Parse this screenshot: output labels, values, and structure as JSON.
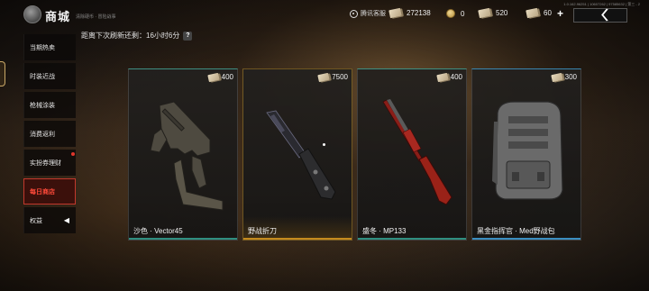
{
  "header": {
    "title": "商城",
    "subtitle": "清除硬币 · 冒险战事",
    "version": "1.0.162.96251 | 10607262 | 97585632 | 第三 - 2",
    "service_label": "腾讯客服",
    "currencies": [
      {
        "icon": "ticket-icon",
        "value": "272138"
      },
      {
        "icon": "coin-icon",
        "value": "0"
      },
      {
        "icon": "ticket-icon",
        "value": "520"
      },
      {
        "icon": "ticket-icon",
        "value": "60"
      }
    ],
    "plus_label": "+",
    "back_label": "〈"
  },
  "refresh": {
    "text": "距离下次刷新还剩：16小时6分",
    "help": "?"
  },
  "sidebar": {
    "items": [
      {
        "label": "当期热卖"
      },
      {
        "label": "时装近战"
      },
      {
        "label": "枪械涂装"
      },
      {
        "label": "消费返利"
      },
      {
        "label": "实扮券理财"
      },
      {
        "label": "每日商店"
      },
      {
        "label": "权益"
      }
    ],
    "active_index": 5
  },
  "cards": [
    {
      "name": "沙色 · Vector45",
      "price": "400",
      "rarity": "teal",
      "accent": "#2f8f80"
    },
    {
      "name": "野战折刀",
      "price": "7500",
      "rarity": "gold",
      "accent": "#c48a1e"
    },
    {
      "name": "盛冬 · MP133",
      "price": "400",
      "rarity": "teal",
      "accent": "#2f8f80"
    },
    {
      "name": "黑金指挥官 · Med野战包",
      "price": "300",
      "rarity": "blue",
      "accent": "#3a8ec0"
    }
  ]
}
